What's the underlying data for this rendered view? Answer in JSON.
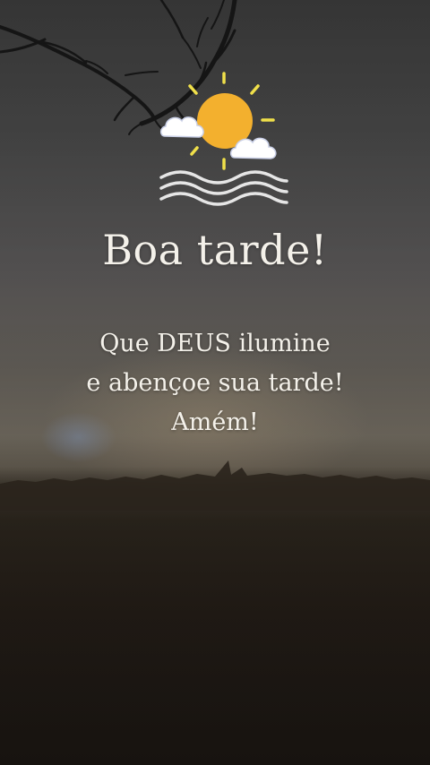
{
  "greeting": {
    "title": "Boa tarde!",
    "lines": [
      "Que DEUS ilumine",
      "e abençoe sua tarde!",
      "Amém!"
    ]
  },
  "icons": {
    "logo": "sun-cloud-waves-icon",
    "background": "sunset-landscape-with-branch"
  },
  "colors": {
    "text": "#f4f1ea",
    "sun": "#f3b02e",
    "sun_rays": "#f0e04a",
    "clouds": "#ffffff",
    "waves": "#e6e6e6"
  }
}
